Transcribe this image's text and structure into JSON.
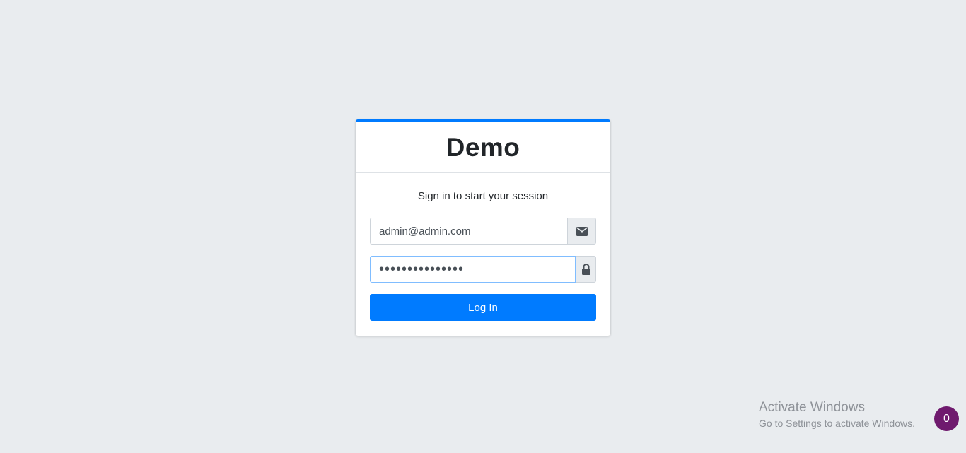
{
  "login": {
    "brand": "Demo",
    "message": "Sign in to start your session",
    "email_value": "admin@admin.com",
    "password_value": "•••••••••••••••",
    "submit_label": "Log In",
    "icons": {
      "email": "envelope-icon",
      "password": "lock-icon"
    },
    "accent_color": "#007bff"
  },
  "watermark": {
    "title": "Activate Windows",
    "subtitle": "Go to Settings to activate Windows."
  },
  "badge": {
    "count": "0",
    "color": "#6f1a6e"
  }
}
